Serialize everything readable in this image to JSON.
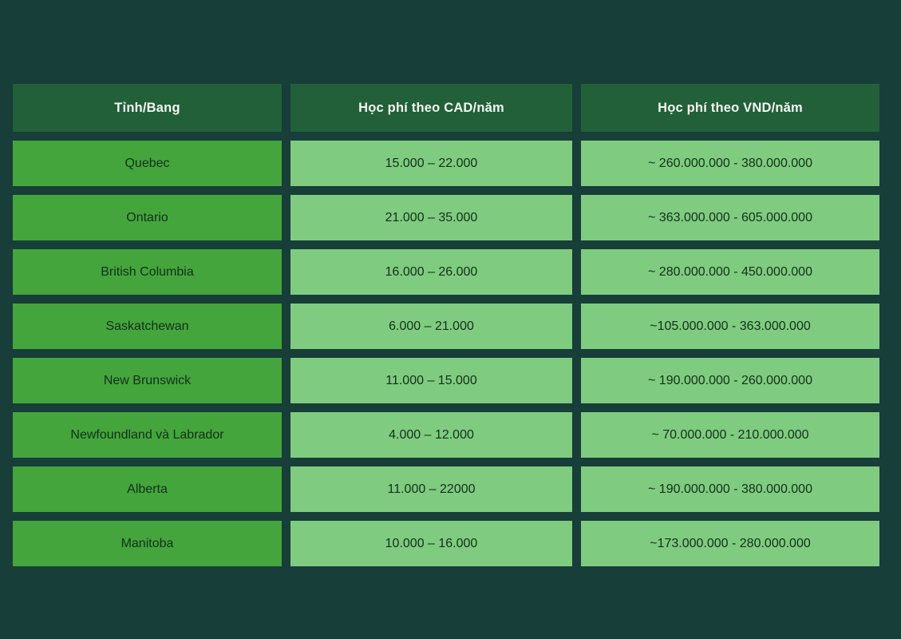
{
  "theme": {
    "background_color": "#173E38",
    "header_cell_color": "#226039",
    "header_text_color": "#F2F7F2",
    "province_cell_color": "#44A53C",
    "value_cell_color": "#7FCB7F",
    "body_text_color": "#13301B"
  },
  "table": {
    "columns": [
      "Tỉnh/Bang",
      "Học phí theo CAD/năm",
      "Học phí theo VND/năm"
    ],
    "rows": [
      {
        "province": "Quebec",
        "cad": "15.000 – 22.000",
        "vnd": "~ 260.000.000 - 380.000.000"
      },
      {
        "province": "Ontario",
        "cad": "21.000 – 35.000",
        "vnd": "~ 363.000.000 - 605.000.000"
      },
      {
        "province": "British Columbia",
        "cad": "16.000 – 26.000",
        "vnd": "~ 280.000.000 - 450.000.000"
      },
      {
        "province": "Saskatchewan",
        "cad": "6.000 – 21.000",
        "vnd": "~105.000.000 - 363.000.000"
      },
      {
        "province": "New Brunswick",
        "cad": "11.000 – 15.000",
        "vnd": "~ 190.000.000 - 260.000.000"
      },
      {
        "province": "Newfoundland và Labrador",
        "cad": "4.000 – 12.000",
        "vnd": "~ 70.000.000 - 210.000.000"
      },
      {
        "province": "Alberta",
        "cad": "11.000 – 22000",
        "vnd": "~ 190.000.000 - 380.000.000"
      },
      {
        "province": "Manitoba",
        "cad": "10.000 – 16.000",
        "vnd": "~173.000.000 - 280.000.000"
      }
    ]
  }
}
